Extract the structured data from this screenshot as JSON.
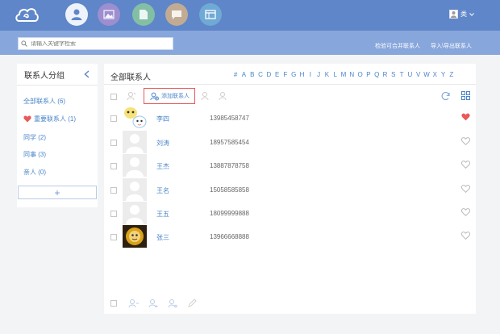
{
  "header": {
    "user_name": "类"
  },
  "search": {
    "placeholder": "请输入关键字检索"
  },
  "subnav": {
    "merge_link": "检验可合并联系人",
    "import_link": "导入\\导出联系人"
  },
  "groups": {
    "title": "联系人分组",
    "items": [
      {
        "label": "全部联系人 (6)"
      },
      {
        "label": "重要联系人 (1)"
      },
      {
        "label": "同学 (2)"
      },
      {
        "label": "同事 (3)"
      },
      {
        "label": "亲人 (0)"
      }
    ],
    "add_symbol": "+"
  },
  "contacts_panel": {
    "title": "全部联系人",
    "alphabet": [
      "#",
      "A",
      "B",
      "C",
      "D",
      "E",
      "F",
      "G",
      "H",
      "I",
      "J",
      "K",
      "L",
      "M",
      "N",
      "O",
      "P",
      "Q",
      "R",
      "S",
      "T",
      "U",
      "V",
      "W",
      "X",
      "Y",
      "Z"
    ],
    "add_contact_label": "添加联系人"
  },
  "contacts": [
    {
      "name": "李四",
      "phone": "13985458747",
      "starred": true,
      "avatar": "cartoon"
    },
    {
      "name": "刘涛",
      "phone": "18957585454",
      "starred": false,
      "avatar": "default"
    },
    {
      "name": "王杰",
      "phone": "13887878758",
      "starred": false,
      "avatar": "default"
    },
    {
      "name": "王名",
      "phone": "15058585858",
      "starred": false,
      "avatar": "default"
    },
    {
      "name": "王五",
      "phone": "18099999888",
      "starred": false,
      "avatar": "default"
    },
    {
      "name": "张三",
      "phone": "13966668888",
      "starred": false,
      "avatar": "photo"
    }
  ],
  "colors": {
    "topbar": "#5f86c8",
    "subbar": "#87a6db",
    "link": "#4a85c9",
    "heart_active": "#e85a5a"
  }
}
